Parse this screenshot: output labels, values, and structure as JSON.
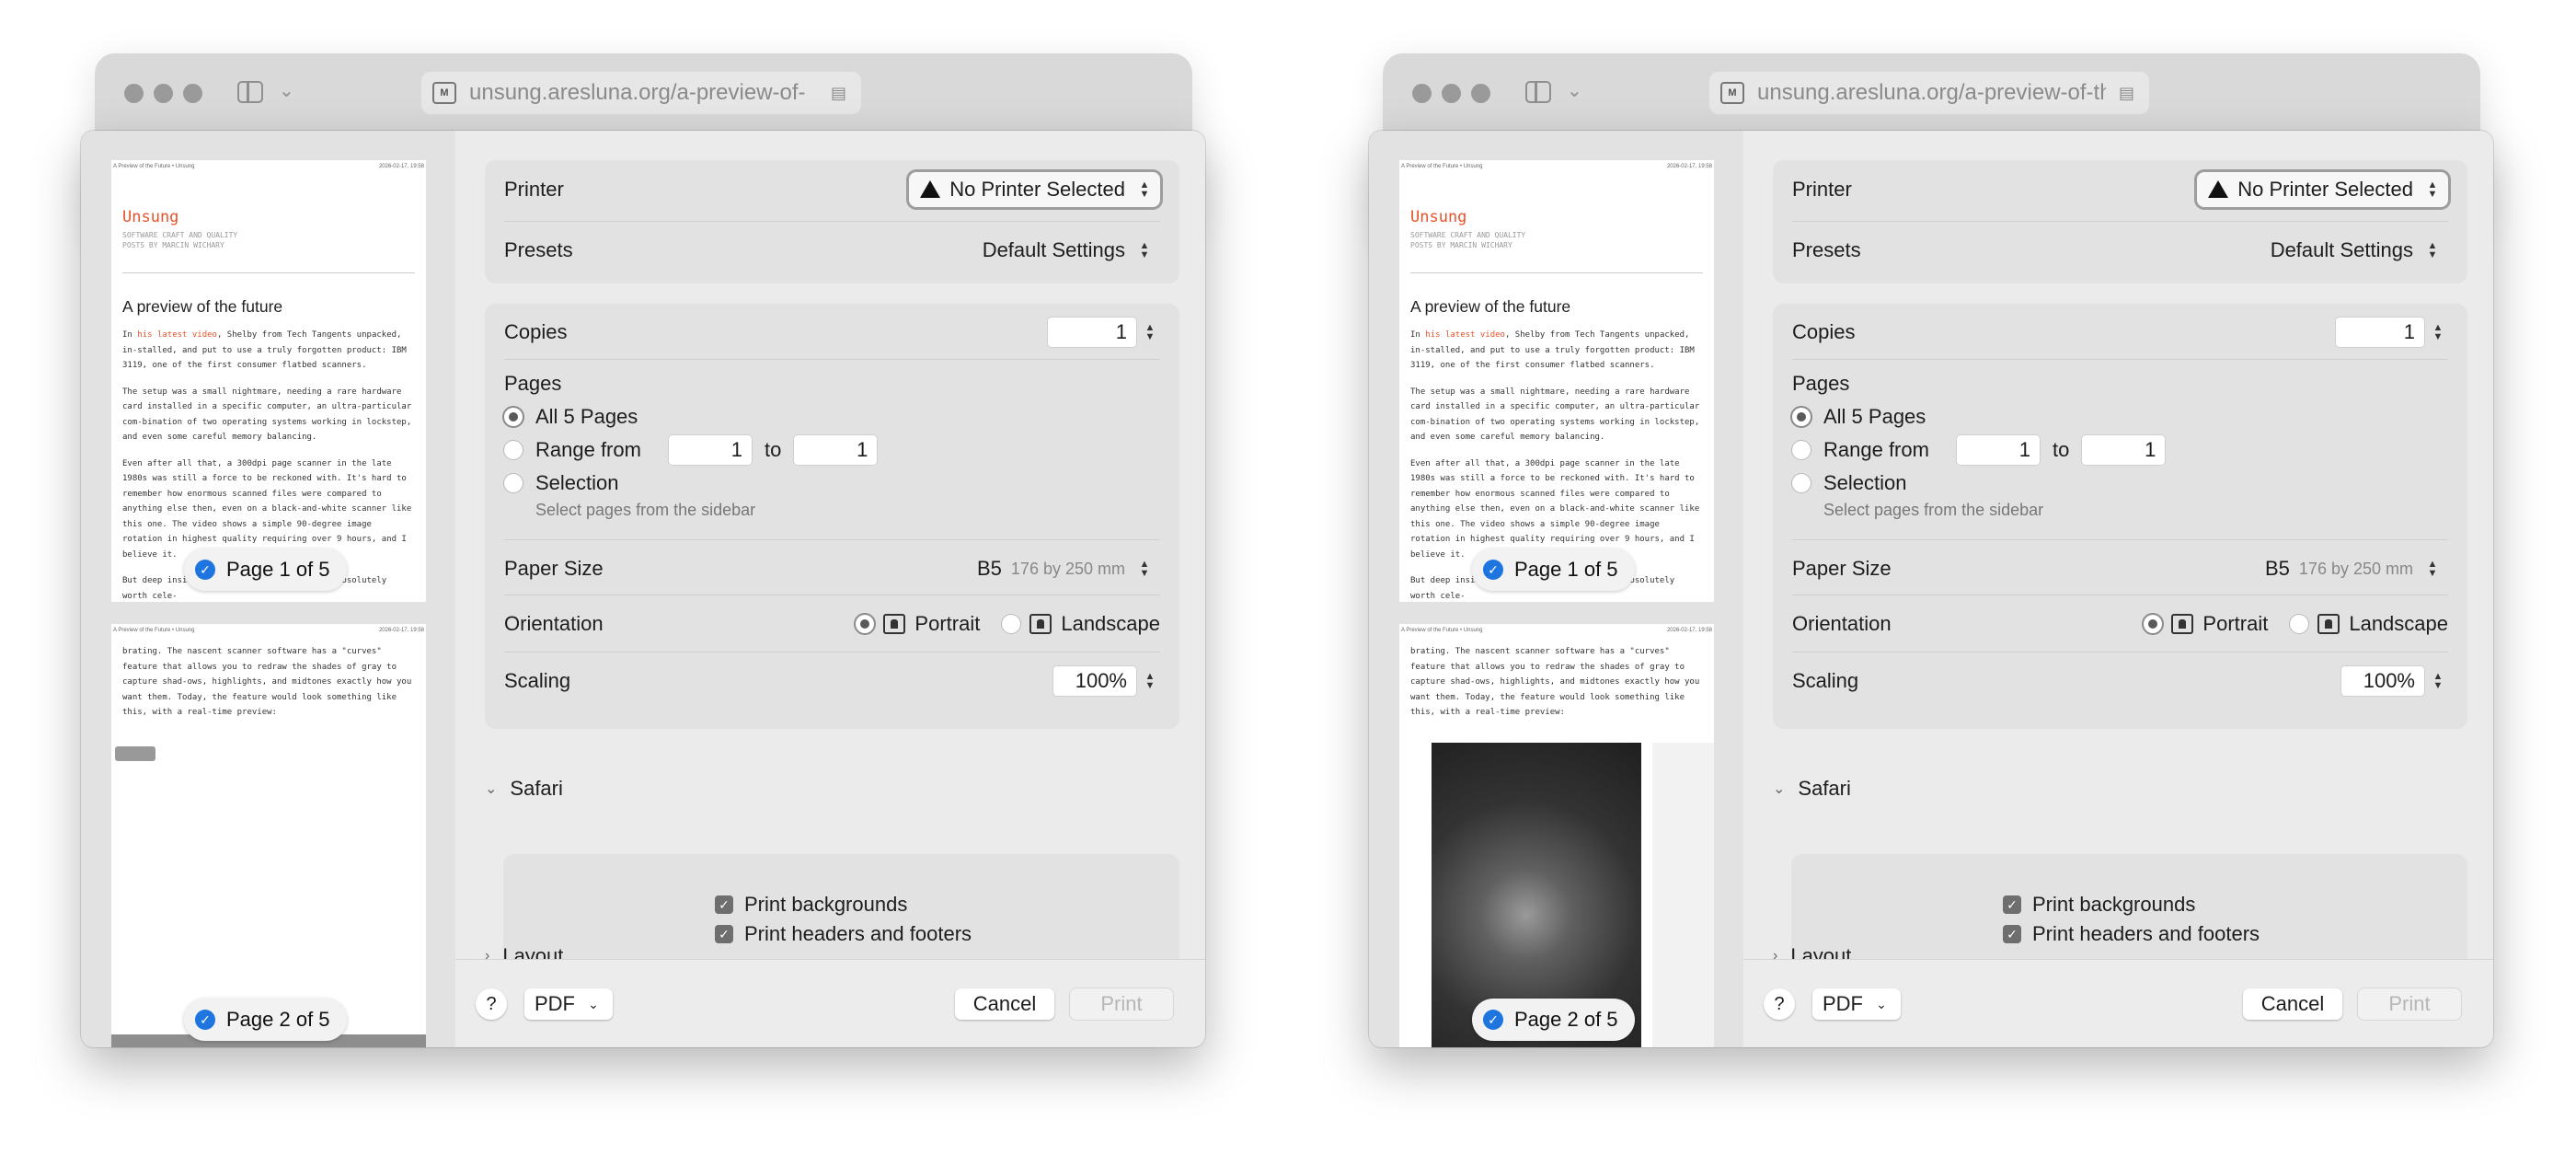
{
  "windows": [
    {
      "url": "unsung.aresluna.org/a-preview-of-",
      "pages": [
        {
          "pill": "Page 1 of 5"
        },
        {
          "pill": "Page 2 of 5"
        }
      ]
    },
    {
      "url": "unsung.aresluna.org/a-preview-of-the",
      "pages": [
        {
          "pill": "Page 1 of 5"
        },
        {
          "pill": "Page 2 of 5"
        }
      ]
    }
  ],
  "preview": {
    "header_left": "A Preview of the Future • Unsung",
    "header_right": "2026-02-17, 19:58",
    "logo": "Unsung",
    "tagline_1": "SOFTWARE CRAFT AND QUALITY",
    "tagline_2": "POSTS BY MARCIN WICHARY",
    "title": "A preview of the future",
    "p1_pre": "In ",
    "p1_link": "his latest video",
    "p1_post": ", Shelby from Tech Tangents unpacked, in-stalled, and put to use a truly forgotten product: IBM 3119, one of the first consumer flatbed scanners.",
    "p2": "The setup was a small nightmare, needing a rare hardware card installed in a specific computer, an ultra-particular com-bination of two operating systems working in lockstep, and even some careful memory balancing.",
    "p3": "Even after all that, a 300dpi page scanner in the late 1980s was still a force to be reckoned with. It's hard to remember how enormous scanned files were compared to anything else then, even on a black-and-white scanner like this one. The video shows a simple 90-degree image rotation in highest quality requiring over 9 hours, and I believe it.",
    "p4": "But deep inside, something appears that is absolutely worth cele-",
    "page2_text": "brating. The nascent scanner software has a \"curves\" feature that allows you to redraw the shades of gray to capture shad-ows, highlights, and midtones exactly how you want them. Today, the feature would look something like this, with a real-time preview:"
  },
  "dialog": {
    "printer_label": "Printer",
    "printer_value": "No Printer Selected",
    "presets_label": "Presets",
    "presets_value": "Default Settings",
    "copies_label": "Copies",
    "copies_value": "1",
    "pages_label": "Pages",
    "all_pages": "All 5 Pages",
    "range_from": "Range from",
    "range_start": "1",
    "range_to": "to",
    "range_end": "1",
    "selection": "Selection",
    "selection_hint": "Select pages from the sidebar",
    "paper_label": "Paper Size",
    "paper_value": "B5",
    "paper_dims": "176 by 250 mm",
    "orientation_label": "Orientation",
    "portrait": "Portrait",
    "landscape": "Landscape",
    "scaling_label": "Scaling",
    "scaling_value": "100%",
    "safari_section": "Safari",
    "print_backgrounds": "Print backgrounds",
    "print_headers": "Print headers and footers",
    "layout_section": "Layout",
    "help": "?",
    "pdf": "PDF",
    "cancel": "Cancel",
    "print": "Print"
  },
  "colors": {
    "accent": "#1f75e0",
    "link": "#e8522b"
  },
  "icons": [
    "warning-icon",
    "sidebar-toggle-icon",
    "chevron-down-icon",
    "portrait-icon",
    "landscape-icon",
    "checkmark-icon"
  ]
}
